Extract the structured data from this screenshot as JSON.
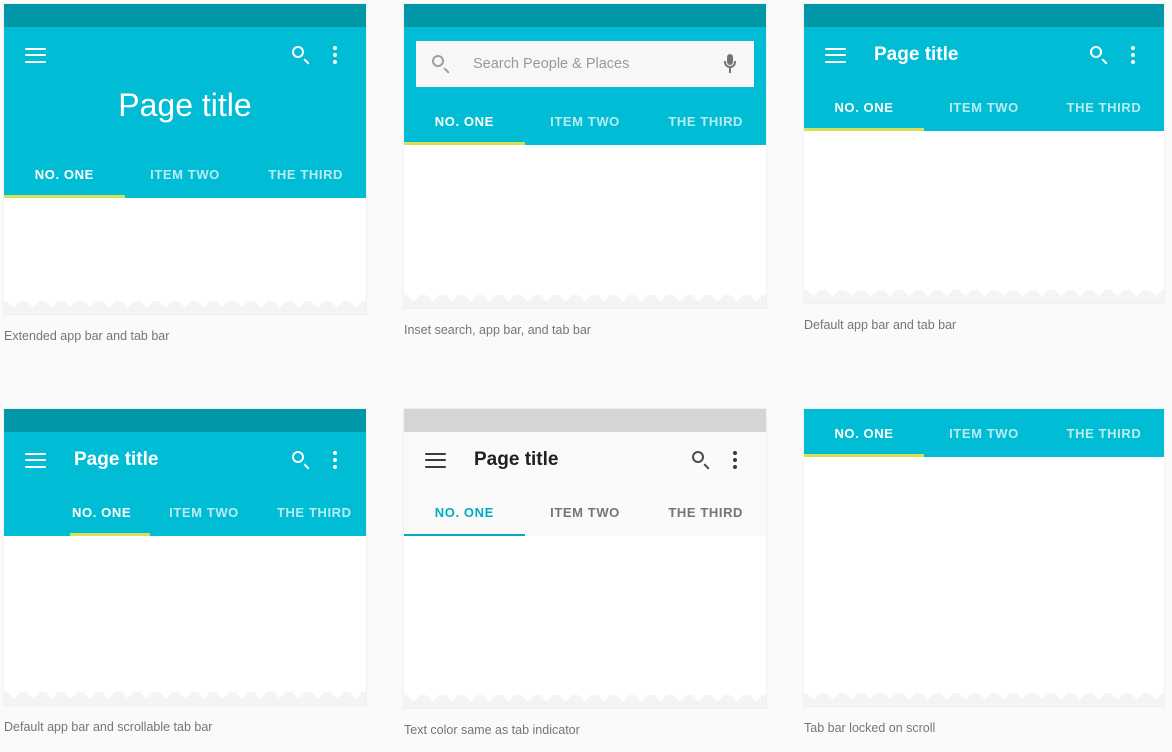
{
  "page": {
    "background": "#fafafa",
    "accent_teal": "#00bcd4",
    "status_teal_dark": "#0097a7",
    "indicator_lime": "#d4e157",
    "indicator_teal": "#00acc1",
    "status_gray": "#d5d5d8"
  },
  "common": {
    "title": "Page title",
    "tabs": [
      {
        "label": "NO. ONE",
        "active": true
      },
      {
        "label": "ITEM TWO",
        "active": false
      },
      {
        "label": "THE THIRD",
        "active": false
      }
    ],
    "icons": {
      "menu": "hamburger-menu-icon",
      "search": "search-icon",
      "overflow": "overflow-menu-icon",
      "mic": "microphone-icon"
    }
  },
  "cards": [
    {
      "id": "extended-app-bar",
      "caption": "Extended app bar and tab bar",
      "title": "Page title",
      "tabs": [
        "NO. ONE",
        "ITEM TWO",
        "THE THIRD"
      ],
      "active_tab": "NO. ONE"
    },
    {
      "id": "inset-search",
      "caption": "Inset search, app bar, and tab bar",
      "search_placeholder": "Search People  & Places",
      "search_value": "",
      "tabs": [
        "NO. ONE",
        "ITEM TWO",
        "THE THIRD"
      ],
      "active_tab": "NO. ONE"
    },
    {
      "id": "default-app-bar",
      "caption": "Default app bar and tab bar",
      "title": "Page title",
      "tabs": [
        "NO. ONE",
        "ITEM TWO",
        "THE THIRD"
      ],
      "active_tab": "NO. ONE"
    },
    {
      "id": "scrollable-tab-bar",
      "caption": "Default app bar and scrollable tab bar",
      "title": "Page title",
      "tabs": [
        "NO. ONE",
        "ITEM TWO",
        "THE THIRD"
      ],
      "active_tab": "NO. ONE"
    },
    {
      "id": "text-color-same-as-indicator",
      "caption": "Text color same as tab indicator",
      "title": "Page title",
      "tabs": [
        "NO. ONE",
        "ITEM TWO",
        "THE THIRD"
      ],
      "active_tab": "NO. ONE"
    },
    {
      "id": "tab-bar-locked-on-scroll",
      "caption": "Tab bar locked on scroll",
      "tabs": [
        "NO. ONE",
        "ITEM TWO",
        "THE THIRD"
      ],
      "active_tab": "NO. ONE"
    }
  ]
}
